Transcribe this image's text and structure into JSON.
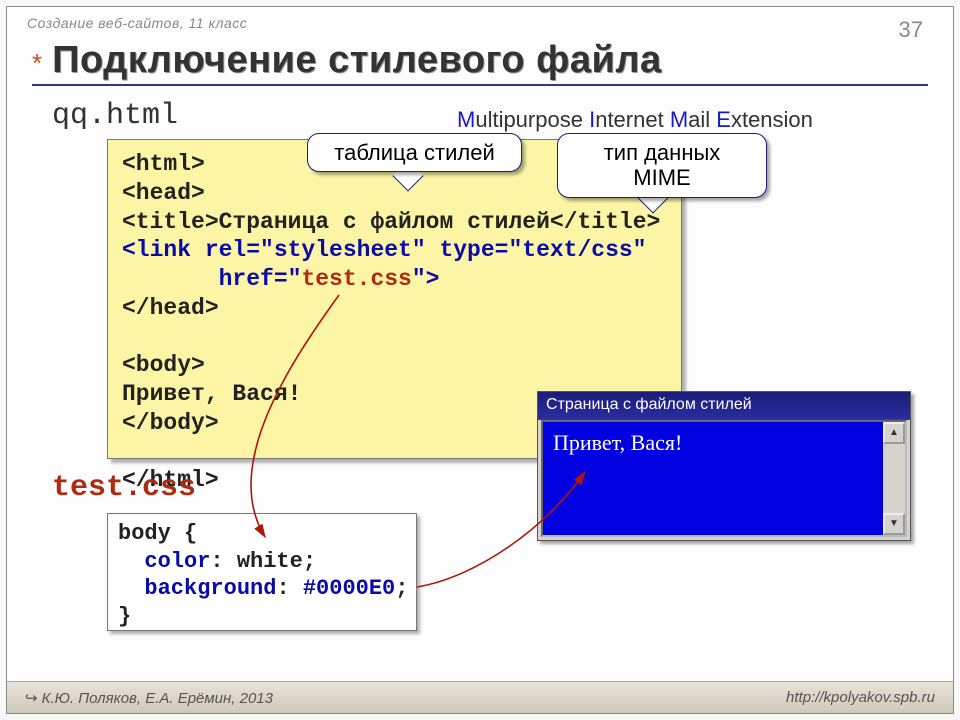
{
  "header": {
    "course": "Создание веб-сайтов, 11 класс",
    "page": "37"
  },
  "title": "Подключение стилевого файла",
  "file1": "qq.html",
  "mime": {
    "M": "M",
    "t1": "ultipurpose ",
    "I": "I",
    "t2": "nternet ",
    "Ma": "M",
    "t3": "ail ",
    "E": "E",
    "t4": "xtension"
  },
  "callouts": {
    "styleTable": "таблица стилей",
    "mimeType": "тип данных MIME"
  },
  "code1": {
    "l1a": "<html>",
    "l2a": "<head>",
    "l3a": "<title>",
    "l3b": "Страница с файлом стилей",
    "l3c": "</title>",
    "l4": "<link rel=\"stylesheet\" type=\"text/css\"",
    "l5a": "       href=\"",
    "l5b": "test.css",
    "l5c": "\">",
    "l6": "</head>",
    "l7a": "<body>",
    "l8": "Привет, Вася!",
    "l9": "</body>",
    "l10": "</html>"
  },
  "file2": "test.css",
  "code2": {
    "l1": "body {",
    "l2a": "  ",
    "l2b": "color",
    "l2c": ": white;",
    "l3a": "  ",
    "l3b": "background",
    "l3c": ": ",
    "l3d": "#0000E0",
    "l3e": ";",
    "l4": "}"
  },
  "preview": {
    "title": "Страница с файлом стилей",
    "body": "Привет, Вася!"
  },
  "footer": {
    "authors": "К.Ю. Поляков, Е.А. Ерёмин, 2013",
    "url": "http://kpolyakov.spb.ru"
  }
}
